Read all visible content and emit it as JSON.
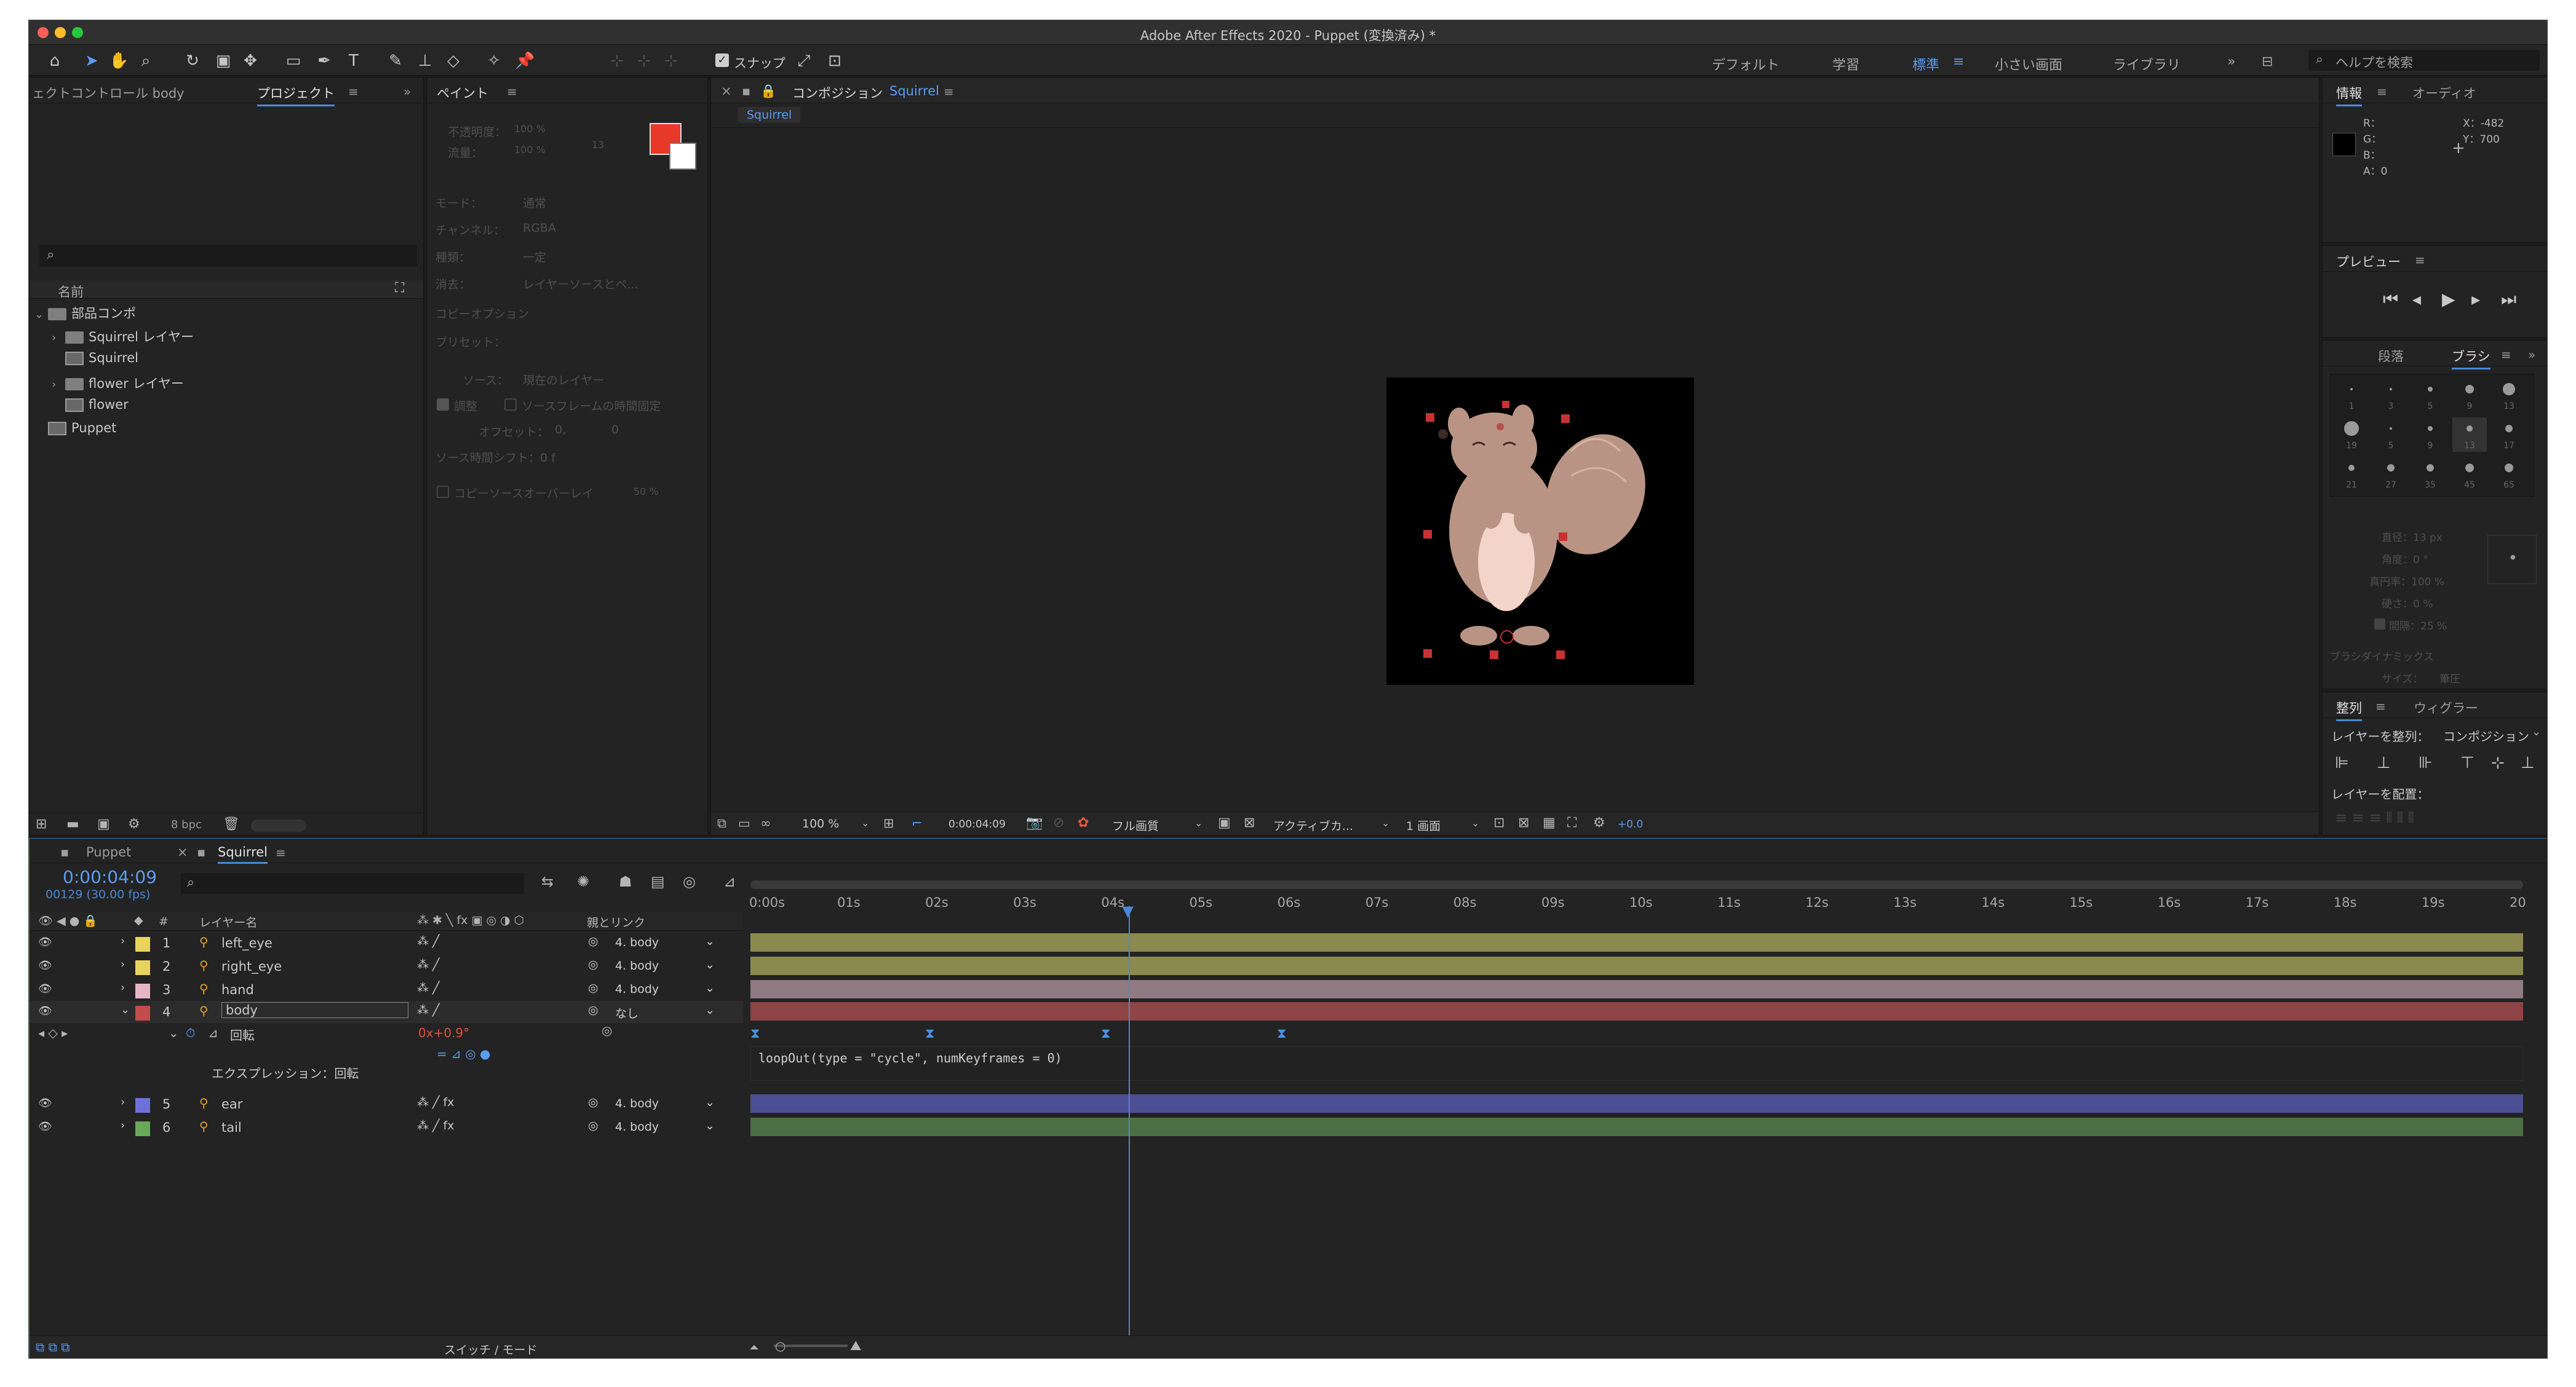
{
  "window": {
    "title": "Adobe After Effects 2020 - Puppet (変換済み) *"
  },
  "toolbar": {
    "snap_label": "スナップ",
    "workspaces": [
      "デフォルト",
      "学習",
      "標準",
      "小さい画面",
      "ライブラリ"
    ],
    "active_workspace": "標準",
    "help_placeholder": "ヘルプを検索"
  },
  "project_panel": {
    "tab_effect_controls": "ェクトコントロール body",
    "tab_project": "プロジェクト",
    "column_name": "名前",
    "bpc": "8 bpc",
    "items": [
      {
        "name": "部品コンポ",
        "type": "folder",
        "depth": 0,
        "expanded": true
      },
      {
        "name": "Squirrel レイヤー",
        "type": "folder",
        "depth": 1,
        "expanded": false
      },
      {
        "name": "Squirrel",
        "type": "comp",
        "depth": 1
      },
      {
        "name": "flower レイヤー",
        "type": "folder",
        "depth": 1,
        "expanded": false
      },
      {
        "name": "flower",
        "type": "comp",
        "depth": 1
      },
      {
        "name": "Puppet",
        "type": "comp",
        "depth": 0
      }
    ]
  },
  "paint_panel": {
    "tab": "ペイント",
    "fields": [
      {
        "label": "不透明度：",
        "value": "100 %"
      },
      {
        "label": "流量：",
        "value": "100 %"
      },
      {
        "label": "モード：",
        "value": "通常"
      },
      {
        "label": "チャンネル：",
        "value": "RGBA"
      },
      {
        "label": "種類：",
        "value": "一定"
      },
      {
        "label": "消去：",
        "value": "レイヤーソースとペ..."
      }
    ],
    "brush_size_top": "13",
    "copy_options": "コピーオプション",
    "preset": "プリセット：",
    "source_label": "ソース：",
    "source_value": "現在のレイヤー",
    "checkbox_adjust": "調整",
    "checkbox_fixed_time": "ソースフレームの時間固定",
    "offset_label": "オフセット：",
    "offset_x": "0,",
    "offset_y": "0",
    "time_shift": "ソース時間シフト：0 f",
    "overlay": "コピーソースオーバーレイ",
    "overlay_value": "50 %",
    "fg_color": "#e8382a",
    "bg_color": "#ffffff"
  },
  "comp_panel": {
    "tab_prefix": "コンポジション",
    "comp_name": "Squirrel",
    "subtab": "Squirrel",
    "zoom": "100 %",
    "timecode": "0:00:04:09",
    "resolution": "フル画質",
    "camera": "アクティブカ...",
    "views": "1 画面",
    "exposure": "+0.0"
  },
  "info_panel": {
    "tab_info": "情報",
    "tab_audio": "オーディオ",
    "r": "R：",
    "g": "G：",
    "b": "B：",
    "a": "A：0",
    "x": "X：-482",
    "y": "Y：700"
  },
  "preview_panel": {
    "tab": "プレビュー"
  },
  "brush_panel": {
    "tab_paragraph": "段落",
    "tab_brush": "ブラシ",
    "sizes": [
      "1",
      "3",
      "5",
      "9",
      "13",
      "19",
      "5",
      "9",
      "13",
      "17",
      "21",
      "27",
      "35",
      "45",
      "65"
    ],
    "diameter": "直径：13 px",
    "angle": "角度：0 °",
    "roundness": "真円率：100 %",
    "hardness": "硬さ：0 %",
    "spacing": "間隔：25 %",
    "dynamics": "ブラシダイナミックス",
    "size_label": "サイズ：",
    "size_value": "筆圧"
  },
  "align_panel": {
    "tab_align": "整列",
    "tab_wiggler": "ウィグラー",
    "align_to_label": "レイヤーを整列：",
    "align_to_value": "コンポジション",
    "distribute_label": "レイヤーを配置："
  },
  "timeline": {
    "tabs": [
      "Puppet",
      "Squirrel"
    ],
    "active_tab": "Squirrel",
    "timecode": "0:00:04:09",
    "frame_info": "00129 (30.00 fps)",
    "col_layer_name": "レイヤー名",
    "col_parent": "親とリンク",
    "ticks": [
      "0:00s",
      "01s",
      "02s",
      "03s",
      "04s",
      "05s",
      "06s",
      "07s",
      "08s",
      "09s",
      "10s",
      "11s",
      "12s",
      "13s",
      "14s",
      "15s",
      "16s",
      "17s",
      "18s",
      "19s",
      "20"
    ],
    "layers": [
      {
        "num": "1",
        "name": "left_eye",
        "parent": "4. body",
        "label": "#e7d45a",
        "bar": "#8a8a4e"
      },
      {
        "num": "2",
        "name": "right_eye",
        "parent": "4. body",
        "label": "#e7d45a",
        "bar": "#8a8a4e"
      },
      {
        "num": "3",
        "name": "hand",
        "parent": "4. body",
        "label": "#e6b6c8",
        "bar": "#8e7a80"
      },
      {
        "num": "4",
        "name": "body",
        "parent": "なし",
        "label": "#c44c4c",
        "bar": "#8e4444"
      },
      {
        "num": "5",
        "name": "ear",
        "parent": "4. body",
        "label": "#6e72d8",
        "bar": "#4c4e94"
      },
      {
        "num": "6",
        "name": "tail",
        "parent": "4. body",
        "label": "#6aa85a",
        "bar": "#4c6e44"
      }
    ],
    "rotation_label": "回転",
    "rotation_value": "0x+0.9°",
    "expression_label": "エクスプレッション：回転",
    "expression_code": "loopOut(type = \"cycle\", numKeyframes = 0)",
    "switch_mode": "スイッチ / モード",
    "playhead_seconds": 4.3
  }
}
